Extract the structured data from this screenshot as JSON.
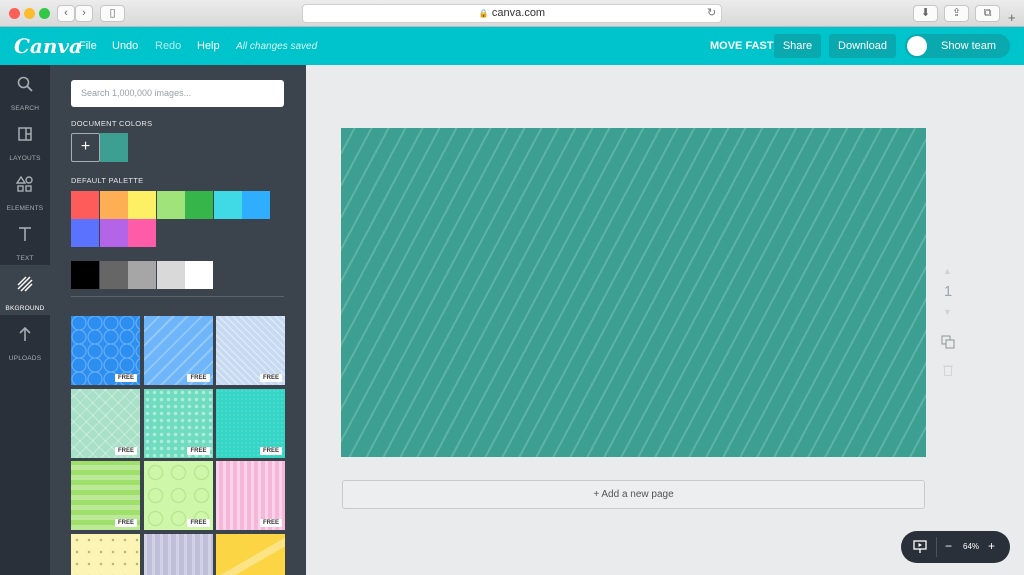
{
  "browser": {
    "url": "canva.com",
    "back_icon": "chevron-left",
    "forward_icon": "chevron-right"
  },
  "topbar": {
    "logo": "Canva",
    "menu": [
      "File",
      "Undo",
      "Redo",
      "Help"
    ],
    "save_status": "All changes saved",
    "team_name": "MOVE FAST",
    "share_label": "Share",
    "download_label": "Download",
    "show_team_label": "Show team",
    "color": "#00c4cc"
  },
  "rail": {
    "items": [
      {
        "label": "SEARCH",
        "icon": "search-icon"
      },
      {
        "label": "LAYOUTS",
        "icon": "layouts-icon"
      },
      {
        "label": "ELEMENTS",
        "icon": "elements-icon"
      },
      {
        "label": "TEXT",
        "icon": "text-icon"
      },
      {
        "label": "BKGROUND",
        "icon": "background-icon",
        "active": true
      },
      {
        "label": "UPLOADS",
        "icon": "upload-icon"
      }
    ]
  },
  "panel": {
    "search_placeholder": "Search 1,000,000 images...",
    "document_colors_title": "DOCUMENT COLORS",
    "document_colors": [
      "#3d9f92"
    ],
    "default_palette_title": "DEFAULT PALETTE",
    "palette_row1": [
      "#fe5b5b",
      "#feae55",
      "#fef065",
      "#a1e37b",
      "#35b54a",
      "#40d9e6",
      "#2faefe"
    ],
    "palette_row2": [
      "#5b72fe",
      "#b464e6",
      "#fe5ca8"
    ],
    "grays": [
      "#000000",
      "#666666",
      "#a6a6a6",
      "#d9d9d9",
      "#ffffff"
    ],
    "free_badge": "FREE",
    "backgrounds": [
      {
        "name": "hexagon-blue",
        "color": "#2b8ef0",
        "free": true
      },
      {
        "name": "chevron-light-blue",
        "color": "#6fb5f9",
        "free": true
      },
      {
        "name": "diagonal-pale-blue",
        "color": "#c8daf2",
        "free": true
      },
      {
        "name": "diamond-mint",
        "color": "#a8e0c8",
        "free": true
      },
      {
        "name": "dots-aqua",
        "color": "#6fdcc0",
        "free": true
      },
      {
        "name": "teal-texture",
        "color": "#33d6c6",
        "free": true
      },
      {
        "name": "stripes-green",
        "color": "#9ee06a",
        "free": true
      },
      {
        "name": "circles-lime",
        "color": "#cff7a9",
        "free": true
      },
      {
        "name": "stripes-pink",
        "color": "#f6b6d9",
        "free": true
      },
      {
        "name": "dots-cream",
        "color": "#fbf4b5",
        "free": false
      },
      {
        "name": "stripes-lavender",
        "color": "#bfbfd9",
        "free": false
      },
      {
        "name": "shapes-yellow",
        "color": "#fbd544",
        "free": false
      }
    ]
  },
  "canvas": {
    "page_number": "1",
    "add_page_label": "+ Add a new page",
    "background_color": "#3d9f92"
  },
  "zoom": {
    "value": "64%",
    "minus": "−",
    "plus": "+"
  }
}
